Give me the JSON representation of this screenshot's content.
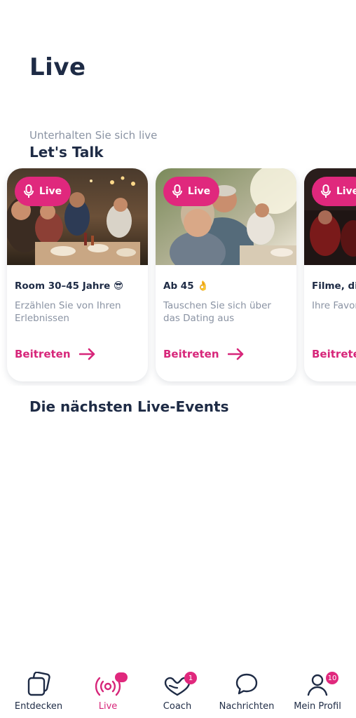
{
  "header": {
    "title": "Live"
  },
  "lets_talk": {
    "subtitle": "Unterhalten Sie sich live",
    "title": "Let's Talk",
    "cards": [
      {
        "badge": "Live",
        "title": "Room 30–45 Jahre 😎",
        "description": "Erzählen Sie von Ihren Erlebnissen",
        "cta": "Beitreten"
      },
      {
        "badge": "Live",
        "title": "Ab 45 👌",
        "description": "Tauschen Sie sich über das Dating aus",
        "cta": "Beitreten"
      },
      {
        "badge": "Live",
        "title": "Filme, die",
        "description": "Ihre Favor",
        "cta": "Beitrete"
      }
    ]
  },
  "events": {
    "title": "Die nächsten Live-Events"
  },
  "nav": {
    "items": [
      {
        "label": "Entdecken",
        "icon": "cards-icon"
      },
      {
        "label": "Live",
        "icon": "broadcast-icon",
        "active": true
      },
      {
        "label": "Coach",
        "icon": "coach-icon",
        "badge": "1"
      },
      {
        "label": "Nachrichten",
        "icon": "chat-bubble-icon"
      },
      {
        "label": "Mein Profil",
        "icon": "profile-icon",
        "badge": "10"
      }
    ]
  },
  "colors": {
    "accent": "#e0287d",
    "text": "#1e2b45",
    "muted": "#8a93a3"
  }
}
